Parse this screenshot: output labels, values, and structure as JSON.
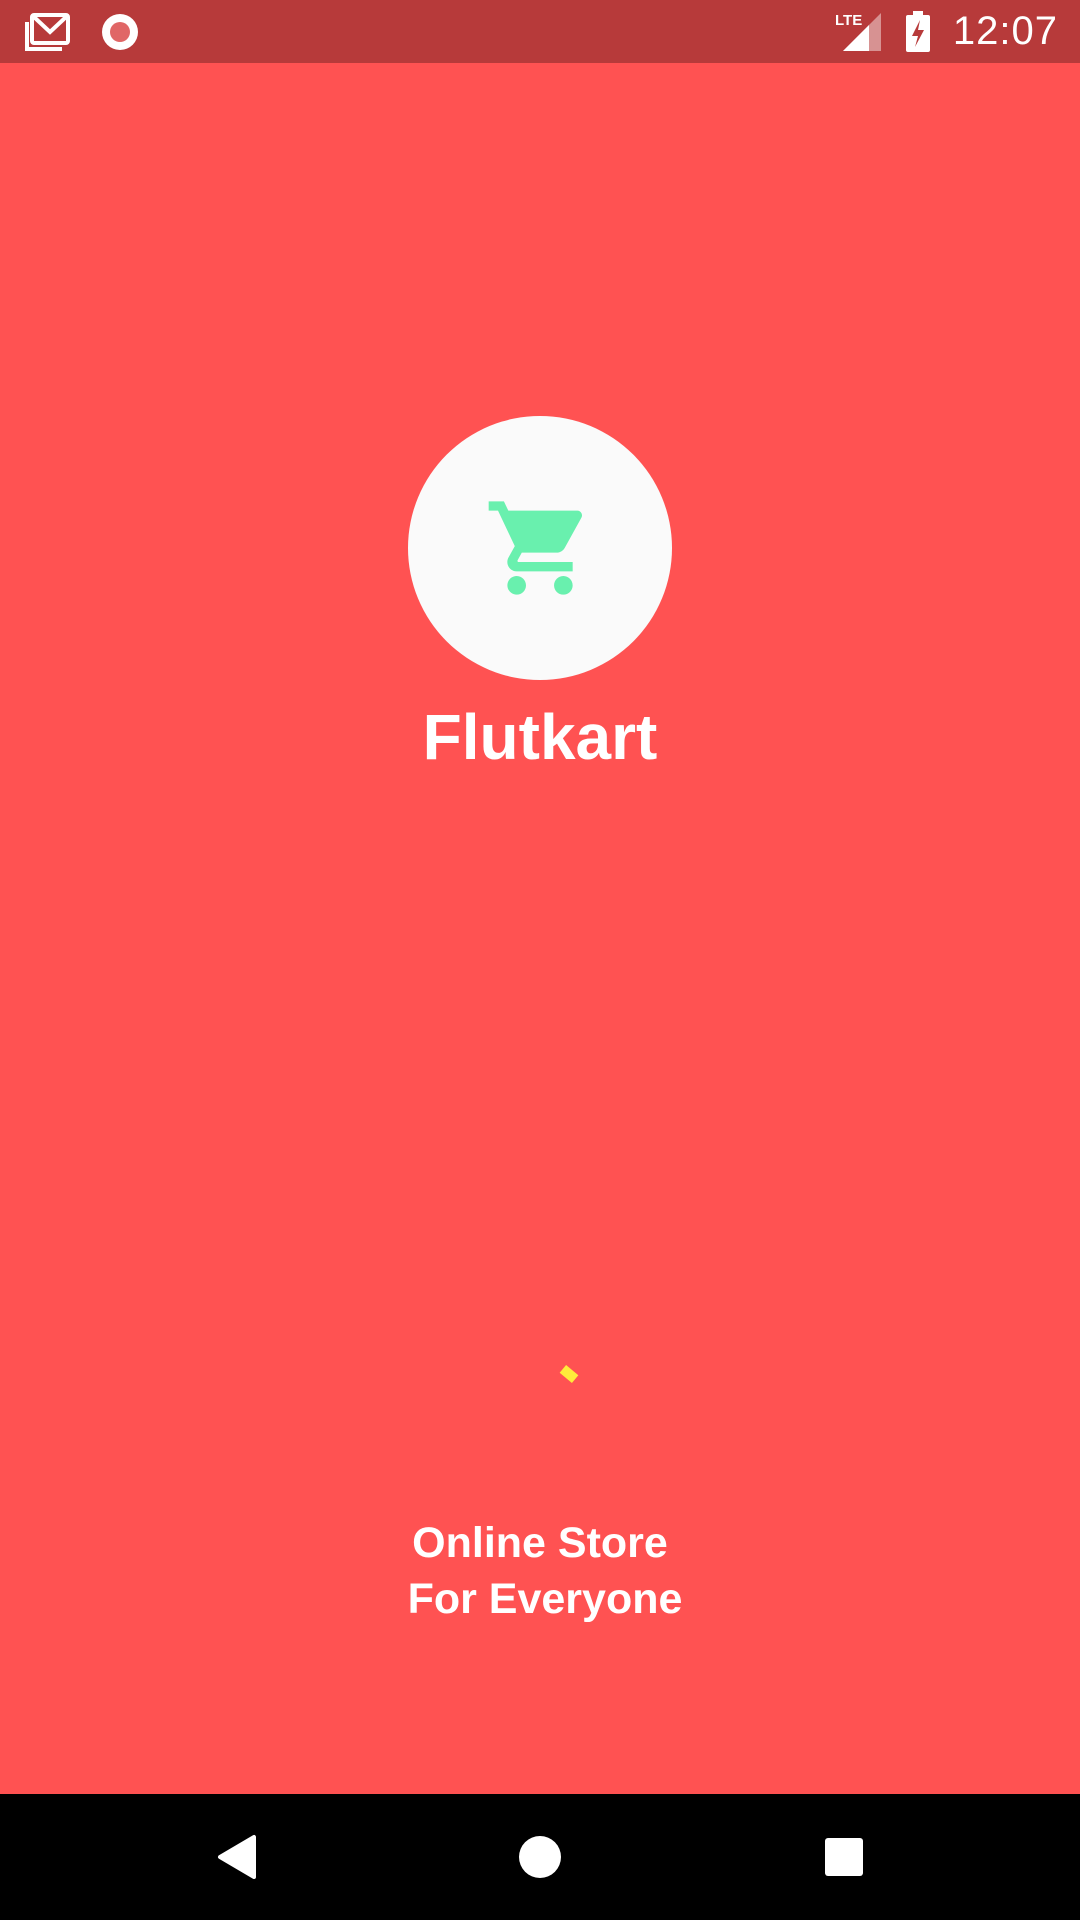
{
  "status_bar": {
    "time": "12:07",
    "network_label": "LTE",
    "left_icons": [
      "gmail-icon",
      "record-icon"
    ],
    "right_icons": [
      "lte-signal-icon",
      "battery-charging-icon"
    ]
  },
  "splash": {
    "app_name": "Flutkart",
    "logo_icon": "shopping-cart-icon",
    "tagline_line1": "Online Store",
    "tagline_line2": "For Everyone",
    "loading": true
  },
  "colors": {
    "background": "#FF5252",
    "status_bar": "#B73A3A",
    "logo_circle": "#FAFAFA",
    "cart_icon": "#69F0AE",
    "loader": "#FFEB3B",
    "nav_bar": "#000000"
  },
  "nav_bar": {
    "buttons": [
      "back-icon",
      "home-icon",
      "recents-icon"
    ]
  }
}
